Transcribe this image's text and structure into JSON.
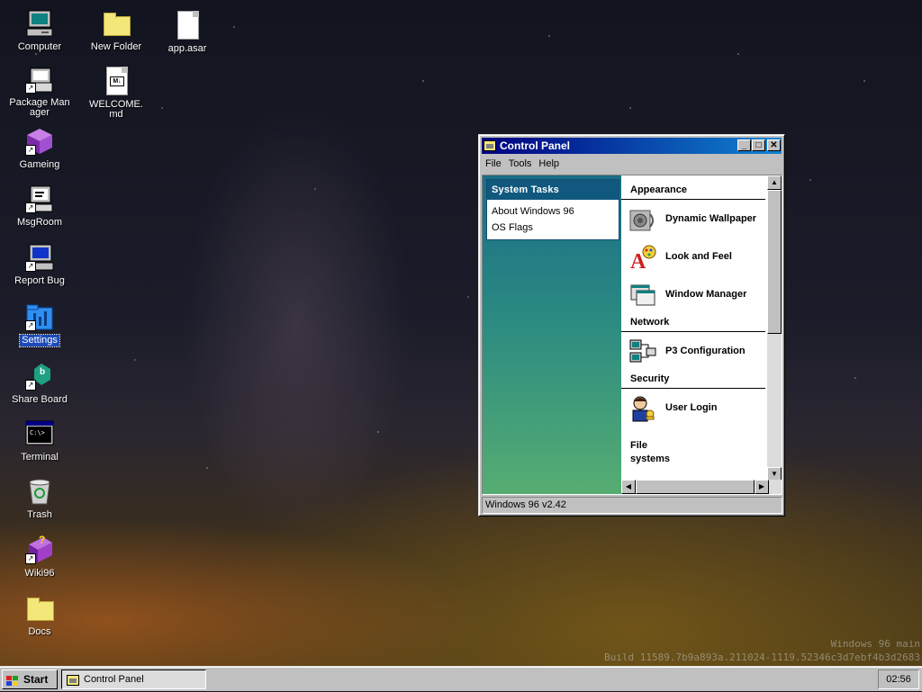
{
  "desktop": {
    "icons": [
      {
        "label": "Computer",
        "icon": "computer-icon"
      },
      {
        "label": "New Folder",
        "icon": "folder-icon"
      },
      {
        "label": "app.asar",
        "icon": "file-icon"
      },
      {
        "label": "Package Manager",
        "icon": "package-manager-icon"
      },
      {
        "label": "WELCOME.md",
        "icon": "markdown-file-icon",
        "badge": "M↓"
      },
      {
        "label": "Gameing",
        "icon": "game-cube-icon"
      },
      {
        "label": "MsgRoom",
        "icon": "msgroom-icon"
      },
      {
        "label": "Report Bug",
        "icon": "report-bug-icon"
      },
      {
        "label": "Settings",
        "icon": "settings-icon"
      },
      {
        "label": "Share Board",
        "icon": "share-board-icon",
        "badge": "b"
      },
      {
        "label": "Terminal",
        "icon": "terminal-icon",
        "badge": "C:\\>"
      },
      {
        "label": "Trash",
        "icon": "trash-icon"
      },
      {
        "label": "Wiki96",
        "icon": "wiki-book-icon",
        "badge": "?"
      },
      {
        "label": "Docs",
        "icon": "folder-icon"
      }
    ],
    "shortcut_arrow": "↗",
    "selected": "Settings"
  },
  "window": {
    "title": "Control Panel",
    "controls": {
      "minimize": "_",
      "maximize": "□",
      "close": "✕"
    },
    "menu": [
      "File",
      "Tools",
      "Help"
    ],
    "tasks": {
      "heading": "System Tasks",
      "items": [
        "About Windows 96",
        "OS Flags"
      ]
    },
    "sections": {
      "appearance": "Appearance",
      "network": "Network",
      "security": "Security",
      "filesystems_line1": "File",
      "filesystems_line2": "systems"
    },
    "items": {
      "dynamic_wallpaper": "Dynamic Wallpaper",
      "look_and_feel": "Look and Feel",
      "window_manager": "Window Manager",
      "p3_configuration": "P3 Configuration",
      "user_login": "User Login"
    },
    "scroll": {
      "up": "▲",
      "down": "▼",
      "left": "◀",
      "right": "▶"
    },
    "status": "Windows 96 v2.42"
  },
  "watermark": {
    "line1": "Windows 96 main",
    "line2": "Build 11589.7b9a893a.211024-1119.52346c3d7ebf4b3d2683"
  },
  "taskbar": {
    "start": "Start",
    "active_task": "Control Panel",
    "clock": "02:56"
  },
  "colors": {
    "titlebar_start": "#000080",
    "titlebar_end": "#1084d0",
    "task_header": "#10587e",
    "selection": "#1c4bb8"
  }
}
